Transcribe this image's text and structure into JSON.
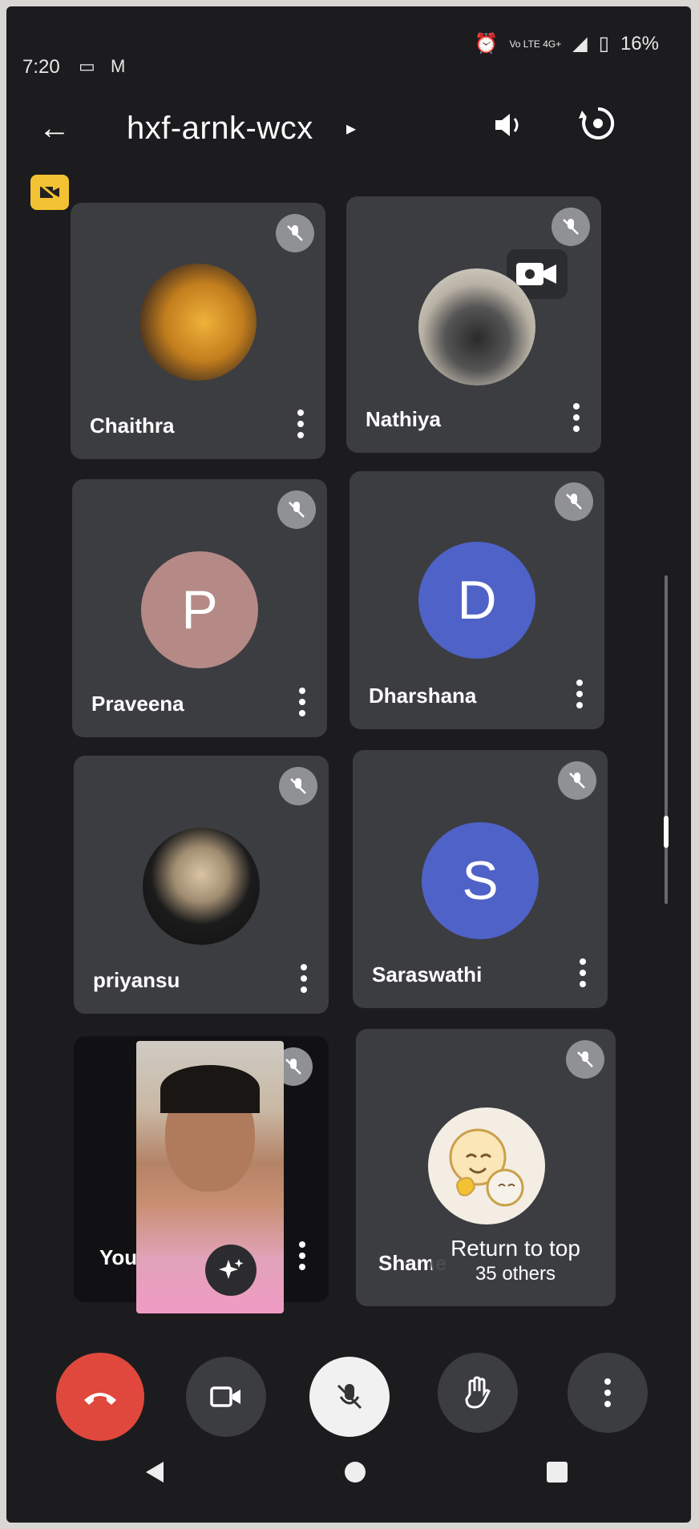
{
  "status": {
    "time": "7:20",
    "network": "Vo LTE 4G+",
    "battery": "16%"
  },
  "meeting": {
    "code": "hxf-arnk-wcx"
  },
  "participants": [
    {
      "name": "Chaithra",
      "avatar": "photo-yellow"
    },
    {
      "name": "Nathiya",
      "avatar": "photo-puppy"
    },
    {
      "name": "Praveena",
      "initial": "P",
      "color": "#b58a86"
    },
    {
      "name": "Dharshana",
      "initial": "D",
      "color": "#4f62c7"
    },
    {
      "name": "priyansu",
      "avatar": "photo-dark"
    },
    {
      "name": "Saraswathi",
      "initial": "S",
      "color": "#4f62c7"
    },
    {
      "name": "You",
      "avatar": "self-view"
    },
    {
      "name": "Shame",
      "avatar": "cartoon"
    }
  ],
  "overlay": {
    "return_label": "Return to top",
    "others": "35 others"
  },
  "controls": [
    "end-call",
    "camera",
    "mic-off",
    "raise-hand",
    "more"
  ],
  "colors": {
    "end_call": "#e0483d",
    "tile": "#3c3d41",
    "background": "#1c1c1f"
  }
}
